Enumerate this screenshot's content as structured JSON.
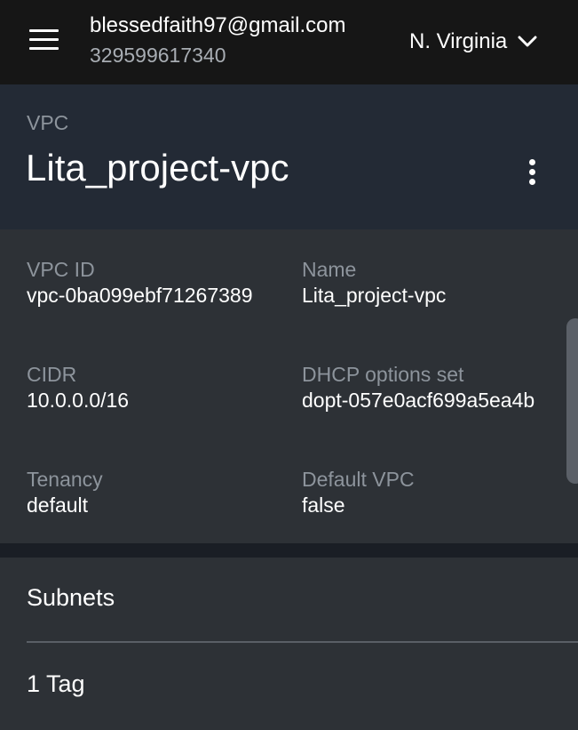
{
  "topbar": {
    "account_email": "blessedfaith97@gmail.com",
    "account_id": "329599617340",
    "region": "N. Virginia"
  },
  "header": {
    "resource_type": "VPC",
    "resource_name": "Lita_project-vpc"
  },
  "details": {
    "vpc_id": {
      "label": "VPC ID",
      "value": "vpc-0ba099ebf71267389"
    },
    "name": {
      "label": "Name",
      "value": "Lita_project-vpc"
    },
    "cidr": {
      "label": "CIDR",
      "value": "10.0.0.0/16"
    },
    "dhcp": {
      "label": "DHCP options set",
      "value": "dopt-057e0acf699a5ea4b"
    },
    "tenancy": {
      "label": "Tenancy",
      "value": "default"
    },
    "default_vpc": {
      "label": "Default VPC",
      "value": "false"
    }
  },
  "sections": {
    "subnets": "Subnets",
    "tags": "1 Tag"
  }
}
